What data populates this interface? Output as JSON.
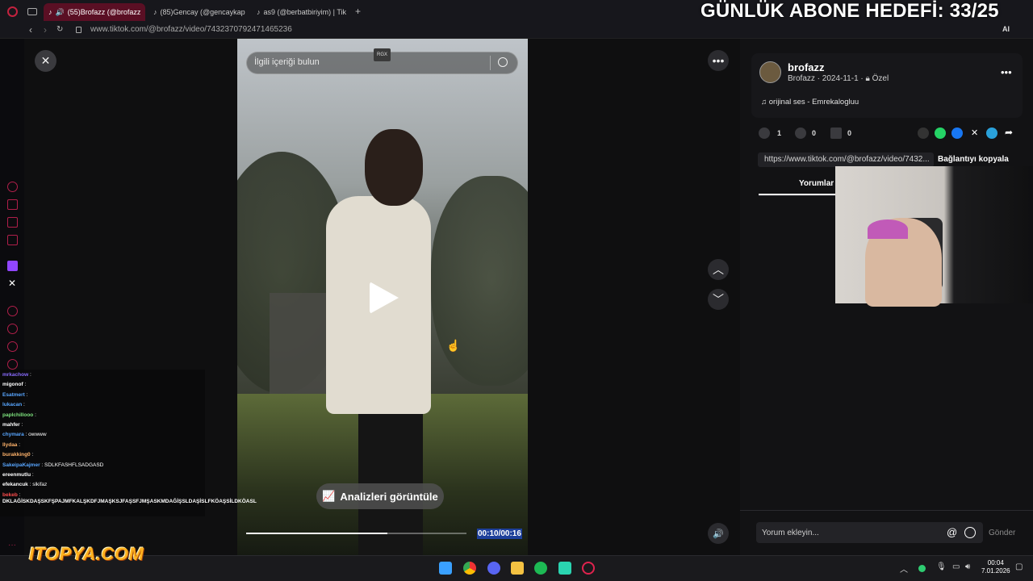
{
  "overlay": {
    "goal_text": "GÜNLÜK ABONE HEDEFİ: 33/25",
    "logo_text": "ITOPYA.COM"
  },
  "browser": {
    "tabs": [
      {
        "label": "(55)Brofazz (@brofazz",
        "active": true
      },
      {
        "label": "(85)Gencay (@gencaykap",
        "active": false
      },
      {
        "label": "as9 (@berbatbiriyim) | Tik",
        "active": false
      }
    ],
    "url": "www.tiktok.com/@brofazz/video/7432370792471465236",
    "toolbar_ai": "AI"
  },
  "player": {
    "search_placeholder": "İlgili içeriği bulun",
    "badge": "RGX",
    "analytics_label": "Analizleri görüntüle",
    "time": "00:10/00:16",
    "progress": 0.64
  },
  "chat": {
    "messages": [
      {
        "user": "mrkachow",
        "text": "",
        "color": "#8a6cff"
      },
      {
        "user": "migonof",
        "text": "",
        "color": "#ffffff"
      },
      {
        "user": "Esatmert",
        "text": "",
        "color": "#58a6ff"
      },
      {
        "user": "lukacan",
        "text": "",
        "color": "#58a6ff"
      },
      {
        "user": "paplchillooo",
        "text": "",
        "color": "#7ee37e"
      },
      {
        "user": "mahfer",
        "text": "",
        "color": "#ffffff"
      },
      {
        "user": "chymara",
        "text": "owwww",
        "color": "#58a6ff"
      },
      {
        "user": "llydaa",
        "text": "",
        "color": "#ffb36b"
      },
      {
        "user": "burakking0",
        "text": "",
        "color": "#ffb36b"
      },
      {
        "user": "SakeipaKajmer",
        "text": "SDLKFASHFLSADGASD",
        "color": "#58a6ff"
      },
      {
        "user": "ereenmutlu",
        "text": "",
        "color": "#ffffff"
      },
      {
        "user": "efekancuk",
        "text": "slkifaz",
        "color": "#ffffff"
      },
      {
        "user": "bekeb",
        "text": "",
        "color": "#ff4d4d"
      }
    ],
    "long_message": "DKLAĞİSKDAŞSKFŞPAJMFKALŞKDFJMAŞKSJFAŞSFJMŞASKMDAĞİŞSLDAŞİSLFKÖAŞSİLDKÖASL"
  },
  "post": {
    "username": "brofazz",
    "meta": "Brofazz · 2024-11-1 · ",
    "privacy": "Özel",
    "music": "orijinal ses - Emrekalogluu",
    "likes": "1",
    "comments": "0",
    "saves": "0",
    "link": "https://www.tiktok.com/@brofazz/video/7432...",
    "copy_label": "Bağlantıyı kopyala",
    "comments_tab": "Yorumlar",
    "comment_placeholder": "Yorum ekleyin...",
    "send_label": "Gönder"
  },
  "taskbar": {
    "time": "00:04",
    "date": "7.01.2026"
  },
  "colors": {
    "accent": "#b01f4a",
    "tiktok_tab": "#5a0f24",
    "time_highlight": "#1d3f9a"
  }
}
